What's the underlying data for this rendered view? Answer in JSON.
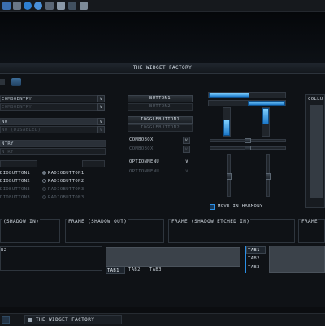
{
  "window": {
    "title": "THE WIDGET FACTORY"
  },
  "left": {
    "combo_entry_1": "COMBOENTRY",
    "combo_entry_2": "COMBOENTRY",
    "combo_1": "NO",
    "combo_2": "NO (DISABLED)",
    "entry_1": "NTRY",
    "entry_2": "NTRY",
    "radios": [
      {
        "col1": "DIOBUTTON1",
        "col2": "RADIOBUTTON1"
      },
      {
        "col1": "DIOBUTTON2",
        "col2": "RADIOBUTTON2"
      },
      {
        "col1": "DIOBUTTON3",
        "col2": "RADIOBUTTON3"
      },
      {
        "col1": "DIOBUTTON3",
        "col2": "RADIOBUTTON3"
      }
    ]
  },
  "middle": {
    "button_1": "BUTTON1",
    "button_2": "BUTTON2",
    "toggle_1": "TOGGLEBUTTON1",
    "toggle_2": "TOGGLEBUTTON2",
    "combobox_1": "COMBOBOX",
    "combobox_2": "COMBOBOX",
    "option_1": "OPTIONMENU",
    "option_2": "OPTIONMENU"
  },
  "right": {
    "move_in_harmony": "MOVE IN HARMONY",
    "scroll_header": "COLLU"
  },
  "frames": {
    "frame_1": "(SHADOW IN)",
    "frame_2": "FRAME (SHADOW OUT)",
    "frame_3": "FRAME (SHADOW ETCHED IN)",
    "frame_4": "FRAME"
  },
  "tabs": {
    "left": [
      "B2"
    ],
    "bottom": [
      "TAB1",
      "TAB2",
      "TAB3"
    ],
    "side": [
      "TAB1",
      "TAB2",
      "TAB3"
    ]
  },
  "taskbar": {
    "window_title": "THE WIDGET FACTORY"
  },
  "colors": {
    "accent": "#2a8fe6",
    "background": "#0f1216"
  }
}
